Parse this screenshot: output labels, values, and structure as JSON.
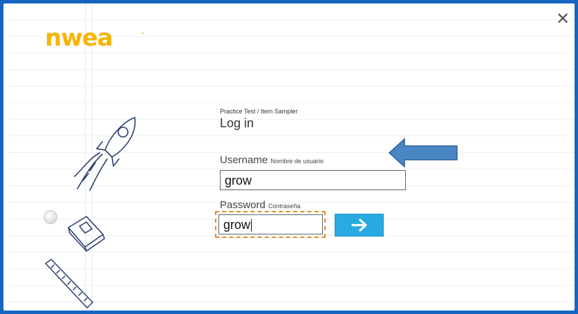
{
  "app": {
    "logo_text": "nwea",
    "logo_tm": "™"
  },
  "header": {
    "close_label": "✕"
  },
  "form": {
    "subtitle": "Practice Test / Item Sampler",
    "title": "Log in",
    "username": {
      "label": "Username",
      "label_es": "Nombre de usuario",
      "value": "grow"
    },
    "password": {
      "label": "Password",
      "label_es": "Contraseña",
      "value": "grow"
    },
    "submit_icon": "right-arrow-icon"
  },
  "colors": {
    "brand": "#f7b500",
    "accent": "#29abe2",
    "frame": "#1565c0",
    "focus": "#e48a21",
    "hint_arrow": "#4a86c5"
  },
  "decorations": [
    "rocket-doodle",
    "book-doodle",
    "ruler-doodle",
    "radio-dot",
    "blue-pointer-arrow"
  ]
}
